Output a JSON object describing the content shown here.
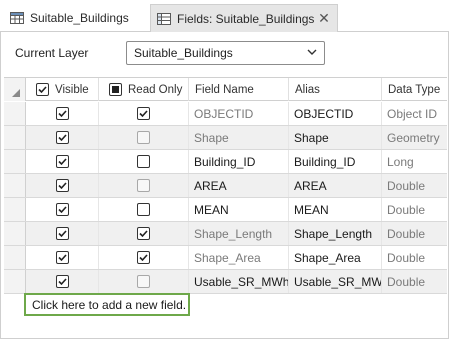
{
  "tabs": [
    {
      "label": "Suitable_Buildings",
      "icon": "table-icon",
      "active": false
    },
    {
      "label": "Fields: Suitable_Buildings",
      "icon": "fields-table-icon",
      "active": true
    }
  ],
  "current_layer": {
    "label": "Current Layer",
    "value": "Suitable_Buildings"
  },
  "columns": {
    "visible": "Visible",
    "read_only": "Read Only",
    "field_name": "Field Name",
    "alias": "Alias",
    "data_type": "Data Type"
  },
  "rows": [
    {
      "visible": true,
      "read_only": true,
      "read_only_disabled": false,
      "field_name": "OBJECTID",
      "alias": "OBJECTID",
      "data_type": "Object ID",
      "greyed": true,
      "shaded": false
    },
    {
      "visible": true,
      "read_only": false,
      "read_only_disabled": true,
      "field_name": "Shape",
      "alias": "Shape",
      "data_type": "Geometry",
      "greyed": true,
      "shaded": true
    },
    {
      "visible": true,
      "read_only": false,
      "read_only_disabled": false,
      "field_name": "Building_ID",
      "alias": "Building_ID",
      "data_type": "Long",
      "greyed": false,
      "shaded": false
    },
    {
      "visible": true,
      "read_only": false,
      "read_only_disabled": true,
      "field_name": "AREA",
      "alias": "AREA",
      "data_type": "Double",
      "greyed": false,
      "shaded": true
    },
    {
      "visible": true,
      "read_only": false,
      "read_only_disabled": false,
      "field_name": "MEAN",
      "alias": "MEAN",
      "data_type": "Double",
      "greyed": false,
      "shaded": false
    },
    {
      "visible": true,
      "read_only": true,
      "read_only_disabled": false,
      "field_name": "Shape_Length",
      "alias": "Shape_Length",
      "data_type": "Double",
      "greyed": true,
      "shaded": true
    },
    {
      "visible": true,
      "read_only": true,
      "read_only_disabled": false,
      "field_name": "Shape_Area",
      "alias": "Shape_Area",
      "data_type": "Double",
      "greyed": true,
      "shaded": false
    },
    {
      "visible": true,
      "read_only": false,
      "read_only_disabled": true,
      "field_name": "Usable_SR_MWh",
      "alias": "Usable_SR_MWh",
      "data_type": "Double",
      "greyed": false,
      "shaded": true
    }
  ],
  "add_field_label": "Click here to add a new field.",
  "colors": {
    "highlight_border": "#6ea84a",
    "greyed_text": "#7a7a7a"
  }
}
